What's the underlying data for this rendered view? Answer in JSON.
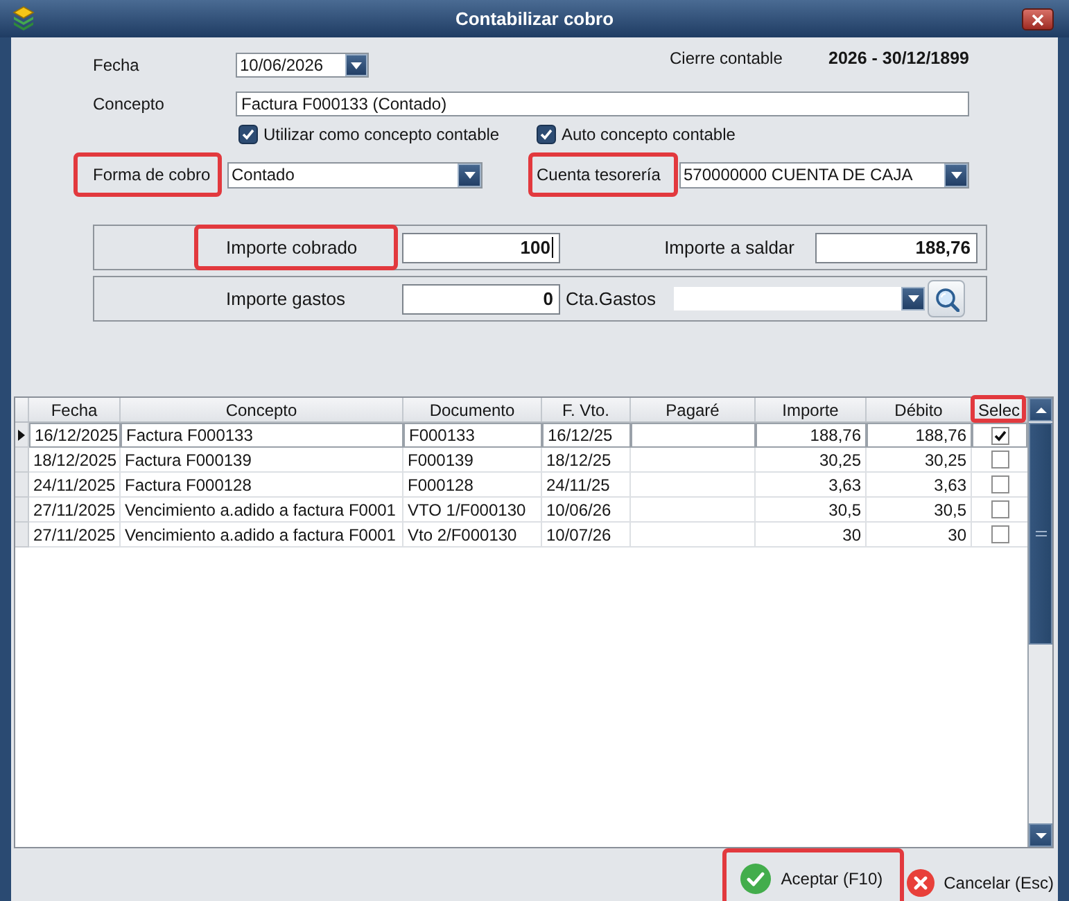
{
  "window": {
    "title": "Contabilizar cobro"
  },
  "form": {
    "fecha": {
      "label": "Fecha",
      "value": "10/06/2026",
      "highlighted": false
    },
    "cierre_contable": {
      "label": "Cierre contable",
      "value": "2026 - 30/12/1899"
    },
    "concepto": {
      "label": "Concepto",
      "value": "Factura F000133 (Contado)",
      "highlighted": false
    },
    "options": [
      {
        "label": "Utilizar como concepto contable",
        "checked": true
      },
      {
        "label": "Auto concepto contable",
        "checked": true
      }
    ],
    "forma_de_cobro": {
      "label": "Forma de cobro",
      "value": "Contado",
      "highlighted": true
    },
    "cuenta_tesoreria": {
      "label": "Cuenta tesorería",
      "value": "570000000 CUENTA DE CAJA",
      "highlighted": true
    }
  },
  "panels": [
    {
      "fields": [
        {
          "kind": "amount",
          "label": "Importe cobrado",
          "value": "100",
          "highlighted": true,
          "focused": true
        },
        {
          "kind": "amount",
          "label": "Importe a saldar",
          "value": "188,76",
          "highlighted": false,
          "focused": false
        }
      ]
    },
    {
      "fields": [
        {
          "kind": "amount",
          "label": "Importe gastos",
          "value": "0",
          "highlighted": false,
          "focused": false
        },
        {
          "kind": "lookup",
          "label": "Cta.Gastos",
          "highlighted": false
        }
      ]
    }
  ],
  "table": {
    "columns": [
      {
        "label": "Fecha",
        "highlighted": false
      },
      {
        "label": "Concepto",
        "highlighted": false
      },
      {
        "label": "Documento",
        "highlighted": false
      },
      {
        "label": "F. Vto.",
        "highlighted": false
      },
      {
        "label": "Pagaré",
        "highlighted": false
      },
      {
        "label": "Importe",
        "highlighted": false
      },
      {
        "label": "Débito",
        "highlighted": false
      },
      {
        "label": "Selec",
        "highlighted": true
      }
    ],
    "rows": [
      {
        "fecha": "16/12/2025",
        "concepto": "Factura F000133",
        "documento": "F000133",
        "f_vto": "16/12/25",
        "importe": "188,76",
        "debito": "188,76",
        "selec": true,
        "selected": true
      },
      {
        "fecha": "18/12/2025",
        "concepto": "Factura F000139",
        "documento": "F000139",
        "f_vto": "18/12/25",
        "importe": "30,25",
        "debito": "30,25",
        "selec": false,
        "selected": false
      },
      {
        "fecha": "24/11/2025",
        "concepto": "Factura F000128",
        "documento": "F000128",
        "f_vto": "24/11/25",
        "importe": "3,63",
        "debito": "3,63",
        "selec": false,
        "selected": false
      },
      {
        "fecha": "27/11/2025",
        "concepto": "Vencimiento a.adido a factura F0001",
        "documento": "VTO 1/F000130",
        "f_vto": "10/06/26",
        "importe": "30,5",
        "debito": "30,5",
        "selec": false,
        "selected": false
      },
      {
        "fecha": "27/11/2025",
        "concepto": "Vencimiento a.adido a factura F0001",
        "documento": "Vto 2/F000130",
        "f_vto": "10/07/26",
        "importe": "30",
        "debito": "30",
        "selec": false,
        "selected": false
      }
    ]
  },
  "buttons": [
    {
      "kind": "accept",
      "label": "Aceptar (F10)",
      "highlighted": true
    },
    {
      "kind": "cancel",
      "label": "Cancelar (Esc)",
      "highlighted": false
    }
  ]
}
